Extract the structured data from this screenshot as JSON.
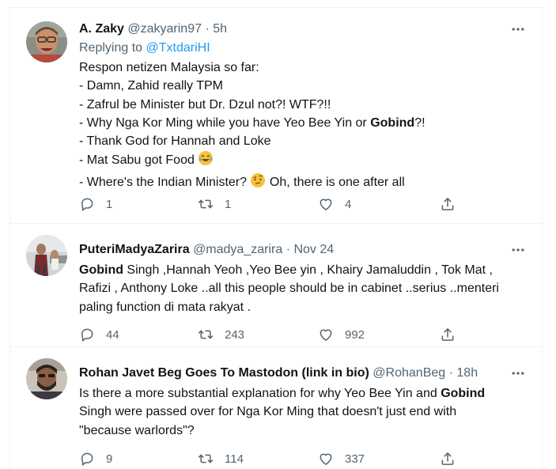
{
  "tweets": [
    {
      "name": "A. Zaky",
      "handle": "@zakyarin97",
      "time": "5h",
      "reply_label": "Replying to",
      "reply_to": "@TxtdariHI",
      "lines": {
        "l1": "Respon netizen Malaysia so far:",
        "l2": "- Damn, Zahid really TPM",
        "l3": "- Zafrul be Minister but Dr. Dzul not?! WTF?!!",
        "l4a": "- Why Nga Kor Ming while you have Yeo Bee Yin or ",
        "l4b": "Gobind",
        "l4c": "?!",
        "l5": "- Thank God for Hannah and Loke",
        "l6": "- Mat Sabu got Food ",
        "l7a": "- Where's the Indian Minister? ",
        "l7b": " Oh, there is one after all"
      },
      "stats": {
        "replies": "1",
        "retweets": "1",
        "likes": "4"
      }
    },
    {
      "name": "PuteriMadyaZarira",
      "handle": "@madya_zarira",
      "time": "Nov 24",
      "lines": {
        "l1a": "Gobind",
        "l1b": " Singh ,Hannah Yeoh ,Yeo Bee yin , Khairy Jamaluddin , Tok Mat ,",
        "l2": "Rafizi , Anthony Loke ..all this people should be in cabinet ..serius ..menteri",
        "l3": "paling function di mata rakyat ."
      },
      "stats": {
        "replies": "44",
        "retweets": "243",
        "likes": "992"
      }
    },
    {
      "name": "Rohan Javet Beg Goes To Mastodon (link in bio)",
      "handle": "@RohanBeg",
      "time": "18h",
      "lines": {
        "l1a": "Is there a more substantial explanation for why Yeo Bee Yin and ",
        "l1b": "Gobind",
        "l2": "Singh were passed over for Nga Kor Ming that doesn't just end with",
        "l3": "\"because warlords\"?"
      },
      "stats": {
        "replies": "9",
        "retweets": "114",
        "likes": "337"
      }
    }
  ],
  "separator": "·",
  "icons": {
    "more": "more-dots-icon",
    "reply": "reply-bubble-icon",
    "retweet": "retweet-icon",
    "like": "heart-icon",
    "share": "share-upload-icon",
    "laugh_emoji": "tears-of-joy-emoji",
    "thinking_emoji": "raised-eyebrow-emoji"
  },
  "colors": {
    "link": "#1d9bf0",
    "muted": "#536471",
    "text": "#0f1419",
    "border": "#eff3f4"
  }
}
